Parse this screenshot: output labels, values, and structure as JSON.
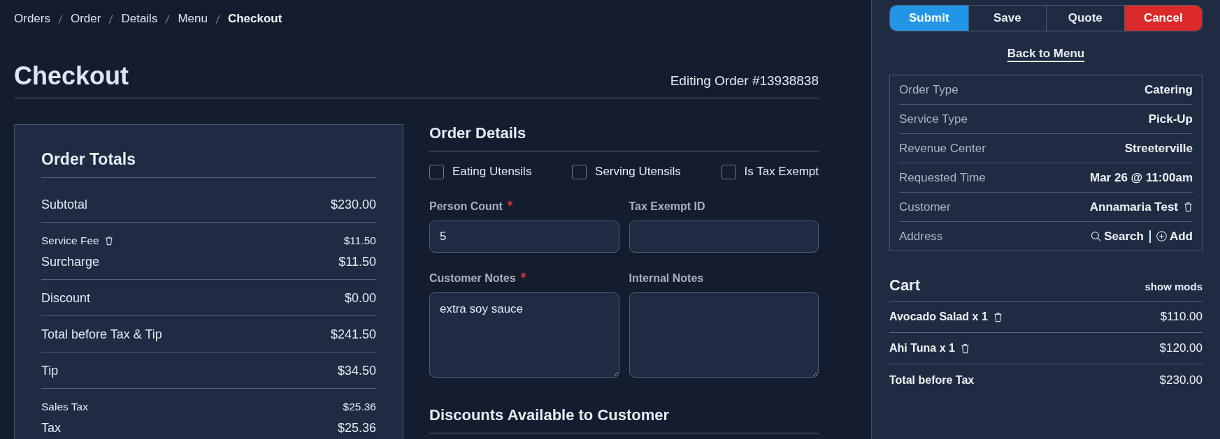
{
  "breadcrumb": [
    {
      "label": "Orders",
      "selected": false
    },
    {
      "label": "Order",
      "selected": false
    },
    {
      "label": "Details",
      "selected": false
    },
    {
      "label": "Menu",
      "selected": false
    },
    {
      "label": "Checkout",
      "selected": true
    }
  ],
  "header": {
    "title": "Checkout",
    "order_number": "Editing Order #13938838"
  },
  "order_totals": {
    "title": "Order Totals",
    "groups": [
      {
        "rows": [
          {
            "label": "Subtotal",
            "value": "$230.00",
            "kind": "major",
            "deletable": false
          }
        ]
      },
      {
        "rows": [
          {
            "label": "Service Fee",
            "value": "$11.50",
            "kind": "minor",
            "deletable": true
          },
          {
            "label": "Surcharge",
            "value": "$11.50",
            "kind": "major",
            "deletable": false
          }
        ]
      },
      {
        "rows": [
          {
            "label": "Discount",
            "value": "$0.00",
            "kind": "major",
            "deletable": false
          }
        ]
      },
      {
        "rows": [
          {
            "label": "Total before Tax & Tip",
            "value": "$241.50",
            "kind": "major",
            "deletable": false
          }
        ]
      },
      {
        "rows": [
          {
            "label": "Tip",
            "value": "$34.50",
            "kind": "major",
            "deletable": false
          }
        ]
      },
      {
        "rows": [
          {
            "label": "Sales Tax",
            "value": "$25.36",
            "kind": "minor",
            "deletable": false
          },
          {
            "label": "Tax",
            "value": "$25.36",
            "kind": "major",
            "deletable": false
          }
        ]
      }
    ]
  },
  "order_details": {
    "title": "Order Details",
    "options": [
      {
        "label": "Eating Utensils",
        "checked": false
      },
      {
        "label": "Serving Utensils",
        "checked": false
      },
      {
        "label": "Is Tax Exempt",
        "checked": false
      }
    ],
    "fields": [
      {
        "label": "Person Count",
        "required": true,
        "kind": "input",
        "value": "5"
      },
      {
        "label": "Tax Exempt ID",
        "required": false,
        "kind": "input"
      },
      {
        "label": "Customer Notes",
        "required": true,
        "kind": "textarea",
        "value": "extra soy sauce"
      },
      {
        "label": "Internal Notes",
        "required": false,
        "kind": "textarea"
      }
    ]
  },
  "discounts": {
    "title": "Discounts Available to Customer"
  },
  "actions": [
    {
      "label": "Submit",
      "kind": "primary"
    },
    {
      "label": "Save",
      "kind": "secondary"
    },
    {
      "label": "Quote",
      "kind": "secondary"
    },
    {
      "label": "Cancel",
      "kind": "danger"
    }
  ],
  "back_link": "Back to Menu",
  "order_info": [
    {
      "label": "Order Type",
      "value": "Catering",
      "deletable": false
    },
    {
      "label": "Service Type",
      "value": "Pick-Up",
      "deletable": false
    },
    {
      "label": "Revenue Center",
      "value": "Streeterville",
      "deletable": false
    },
    {
      "label": "Requested Time",
      "value": "Mar 26 @ 11:00am",
      "deletable": false
    },
    {
      "label": "Customer",
      "value": "Annamaria Test",
      "deletable": true
    },
    {
      "label": "Address",
      "deletable": false,
      "actions": [
        {
          "label": "Search",
          "kind": "search"
        },
        {
          "label": "Add",
          "kind": "add"
        }
      ]
    }
  ],
  "cart": {
    "title": "Cart",
    "toggle": "show mods",
    "items": [
      {
        "name": "Avocado Salad x 1",
        "price": "$110.00",
        "deletable": true
      },
      {
        "name": "Ahi Tuna x 1",
        "price": "$120.00",
        "deletable": true
      }
    ],
    "total": {
      "label": "Total before Tax",
      "value": "$230.00"
    }
  }
}
